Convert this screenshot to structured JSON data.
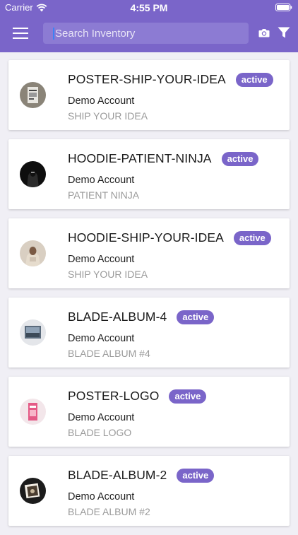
{
  "status_bar": {
    "carrier": "Carrier",
    "time": "4:55 PM"
  },
  "header": {
    "menu_icon": "hamburger-menu-icon",
    "search_placeholder": "Search Inventory",
    "camera_icon": "camera-icon",
    "filter_icon": "filter-icon",
    "accent_color": "#7a65c9"
  },
  "inventory": [
    {
      "sku": "POSTER-SHIP-YOUR-IDEA",
      "status": "active",
      "account": "Demo Account",
      "product": "SHIP YOUR IDEA",
      "thumbnail": "poster-thumbnail"
    },
    {
      "sku": "HOODIE-PATIENT-NINJA",
      "status": "active",
      "account": "Demo Account",
      "product": "PATIENT NINJA",
      "thumbnail": "hoodie-thumbnail"
    },
    {
      "sku": "HOODIE-SHIP-YOUR-IDEA",
      "status": "active",
      "account": "Demo Account",
      "product": "SHIP YOUR IDEA",
      "thumbnail": "hoodie-thumbnail"
    },
    {
      "sku": "BLADE-ALBUM-4",
      "status": "active",
      "account": "Demo Account",
      "product": "BLADE ALBUM #4",
      "thumbnail": "album-thumbnail"
    },
    {
      "sku": "POSTER-LOGO",
      "status": "active",
      "account": "Demo Account",
      "product": "BLADE LOGO",
      "thumbnail": "poster-thumbnail"
    },
    {
      "sku": "BLADE-ALBUM-2",
      "status": "active",
      "account": "Demo Account",
      "product": "BLADE ALBUM #2",
      "thumbnail": "album-thumbnail"
    }
  ]
}
